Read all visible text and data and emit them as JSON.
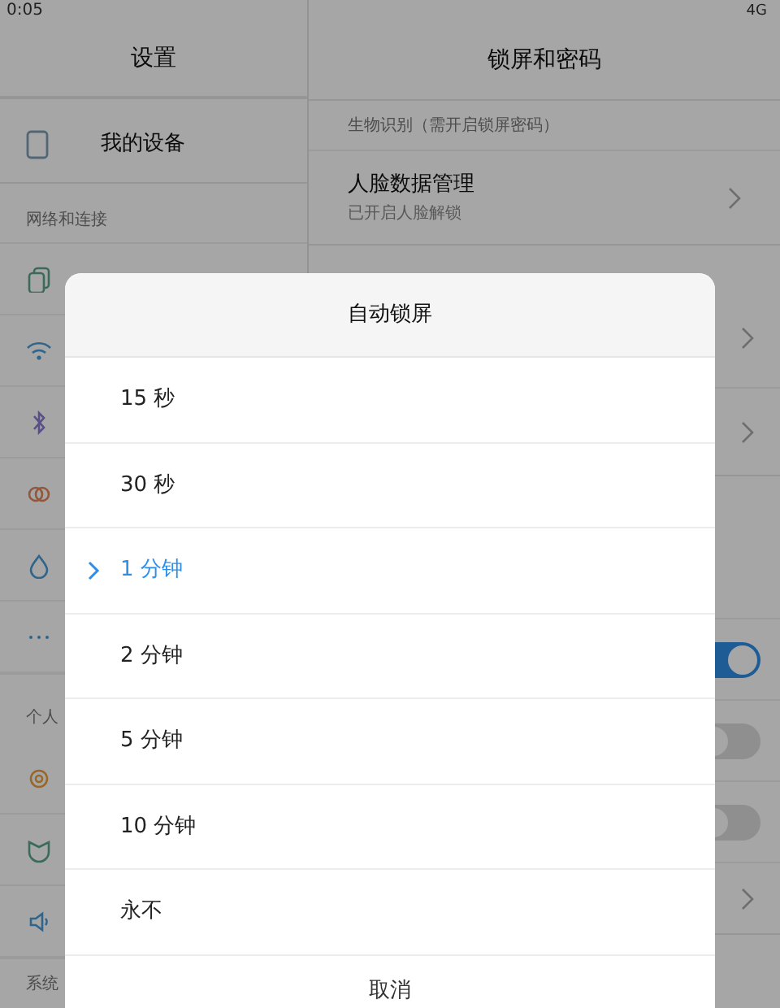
{
  "status_bar": {
    "time": "0:05",
    "network": "4G"
  },
  "settings_pane": {
    "title": "设置",
    "device_item": "我的设备",
    "sections": [
      "网络和连接",
      "个人",
      "系统"
    ]
  },
  "lock_pane": {
    "title": "锁屏和密码",
    "biometric_header": "生物识别（需开启锁屏密码）",
    "face_item": {
      "title": "人脸数据管理",
      "subtitle": "已开启人脸解锁"
    },
    "toggles": [
      {
        "on": true
      },
      {
        "on": false
      },
      {
        "on": false
      }
    ]
  },
  "dialog": {
    "title": "自动锁屏",
    "options": [
      {
        "label": "15 秒",
        "selected": false
      },
      {
        "label": "30 秒",
        "selected": false
      },
      {
        "label": "1 分钟",
        "selected": true
      },
      {
        "label": "2 分钟",
        "selected": false
      },
      {
        "label": "5 分钟",
        "selected": false
      },
      {
        "label": "10 分钟",
        "selected": false
      },
      {
        "label": "永不",
        "selected": false
      }
    ],
    "cancel": "取消"
  }
}
